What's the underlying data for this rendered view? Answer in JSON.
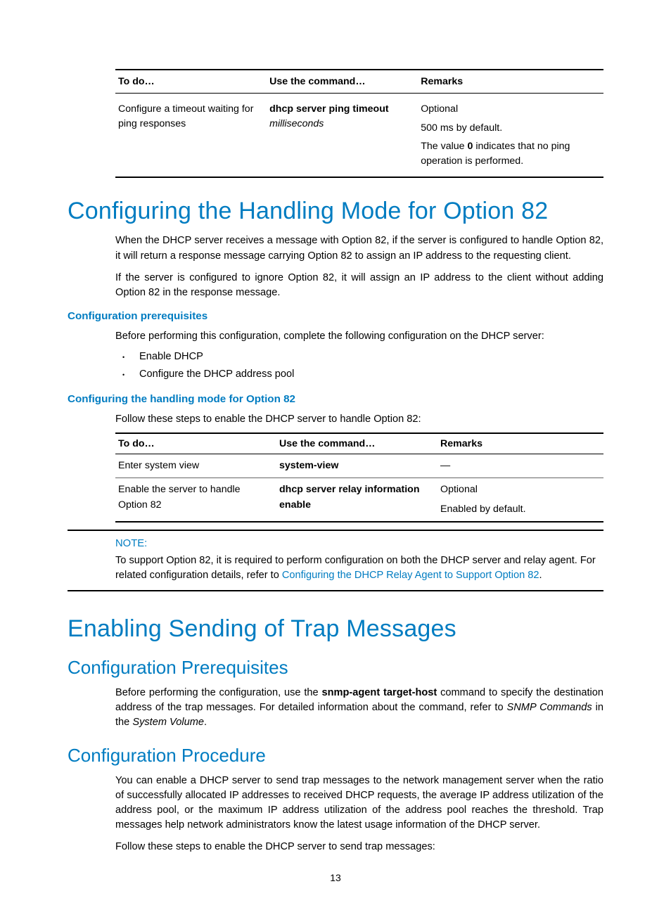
{
  "table1": {
    "headers": [
      "To do…",
      "Use the command…",
      "Remarks"
    ],
    "row": {
      "todo": "Configure a timeout waiting for ping responses",
      "cmd_bold": "dhcp server ping timeout",
      "cmd_ital": "milliseconds",
      "remark1": "Optional",
      "remark2": "500 ms by default.",
      "remark3_pre": "The value ",
      "remark3_bold": "0",
      "remark3_post": " indicates that no ping operation is performed."
    }
  },
  "h1a": "Configuring the Handling Mode for Option 82",
  "p1": "When the DHCP server receives a message with Option 82, if the server is configured to handle Option 82, it will return a response message carrying Option 82 to assign an IP address to the requesting client.",
  "p2": "If the server is configured to ignore Option 82, it will assign an IP address to the client without adding Option 82 in the response message.",
  "h3a": "Configuration prerequisites",
  "p3": "Before performing this configuration, complete the following configuration on the DHCP server:",
  "bul": [
    "Enable DHCP",
    "Configure the DHCP address pool"
  ],
  "h3b": "Configuring the handling mode for Option 82",
  "p4": "Follow these steps to enable the DHCP server to handle Option 82:",
  "table2": {
    "headers": [
      "To do…",
      "Use the command…",
      "Remarks"
    ],
    "r1": {
      "todo": "Enter system view",
      "cmd": "system-view",
      "remark": "—"
    },
    "r2": {
      "todo": "Enable the server to handle Option 82",
      "cmd": "dhcp server relay information enable",
      "remark1": "Optional",
      "remark2": "Enabled by default."
    }
  },
  "note": {
    "label": "NOTE:",
    "text_pre": "To support Option 82, it is required to perform configuration on both the DHCP server and relay agent. For related configuration details, refer to ",
    "link": "Configuring the DHCP Relay Agent to Support Option 82",
    "text_post": "."
  },
  "h1b": "Enabling Sending of Trap Messages",
  "h2a": "Configuration Prerequisites",
  "p5_pre": "Before performing the configuration, use the ",
  "p5_bold": "snmp-agent target-host",
  "p5_mid": " command to specify the destination address of the trap messages. For detailed information about the command, refer to ",
  "p5_ital1": "SNMP Commands",
  "p5_mid2": " in the ",
  "p5_ital2": "System Volume",
  "p5_post": ".",
  "h2b": "Configuration Procedure",
  "p6": "You can enable a DHCP server to send trap messages to the network management server when the ratio of successfully allocated IP addresses to received DHCP requests, the average IP address utilization of the address pool, or the maximum IP address utilization of the address pool reaches the threshold. Trap messages help network administrators know the latest usage information of the DHCP server.",
  "p7": "Follow these steps to enable the DHCP server to send trap messages:",
  "pagenum": "13",
  "chart_data": {
    "type": "table",
    "tables": [
      {
        "headers": [
          "To do…",
          "Use the command…",
          "Remarks"
        ],
        "rows": [
          [
            "Configure a timeout waiting for ping responses",
            "dhcp server ping timeout milliseconds",
            "Optional; 500 ms by default. The value 0 indicates that no ping operation is performed."
          ]
        ]
      },
      {
        "headers": [
          "To do…",
          "Use the command…",
          "Remarks"
        ],
        "rows": [
          [
            "Enter system view",
            "system-view",
            "—"
          ],
          [
            "Enable the server to handle Option 82",
            "dhcp server relay information enable",
            "Optional; Enabled by default."
          ]
        ]
      }
    ]
  }
}
